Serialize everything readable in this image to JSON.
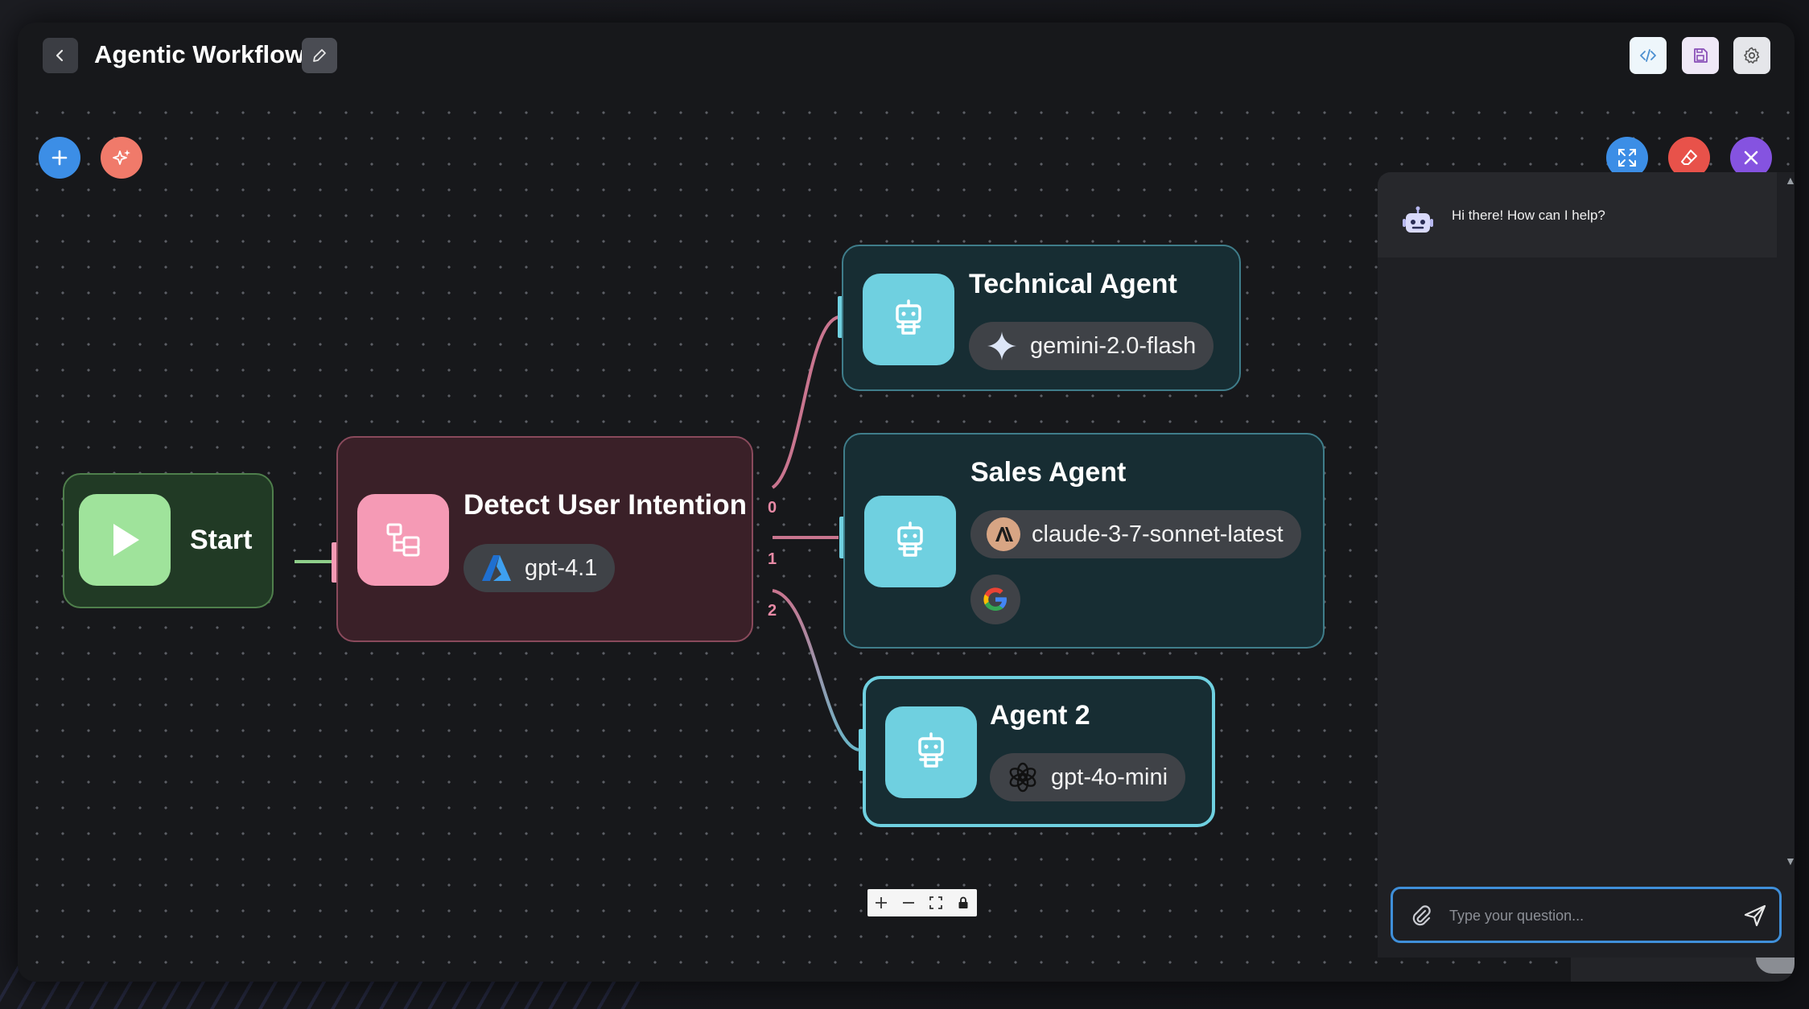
{
  "header": {
    "title": "Agentic Workflow"
  },
  "nodes": {
    "start": {
      "label": "Start"
    },
    "detect": {
      "title": "Detect User Intention",
      "model": "gpt-4.1"
    },
    "technical": {
      "title": "Technical Agent",
      "model": "gemini-2.0-flash"
    },
    "sales": {
      "title": "Sales Agent",
      "model": "claude-3-7-sonnet-latest"
    },
    "agent2": {
      "title": "Agent 2",
      "model": "gpt-4o-mini"
    }
  },
  "edges": {
    "labels": [
      "0",
      "1",
      "2"
    ]
  },
  "chat": {
    "greeting": "Hi there! How can I help?",
    "input_placeholder": "Type your question..."
  },
  "colors": {
    "start_node": "#9fe39b",
    "router_node": "#f59ab5",
    "agent_icon": "#6fd0e0",
    "add_button": "#3c8ee6",
    "magic_button": "#f07a6a",
    "fullscreen_button": "#3c8ee6",
    "clear_button": "#e8524a",
    "close_button": "#8553e0",
    "input_border": "#3f8fd9"
  }
}
